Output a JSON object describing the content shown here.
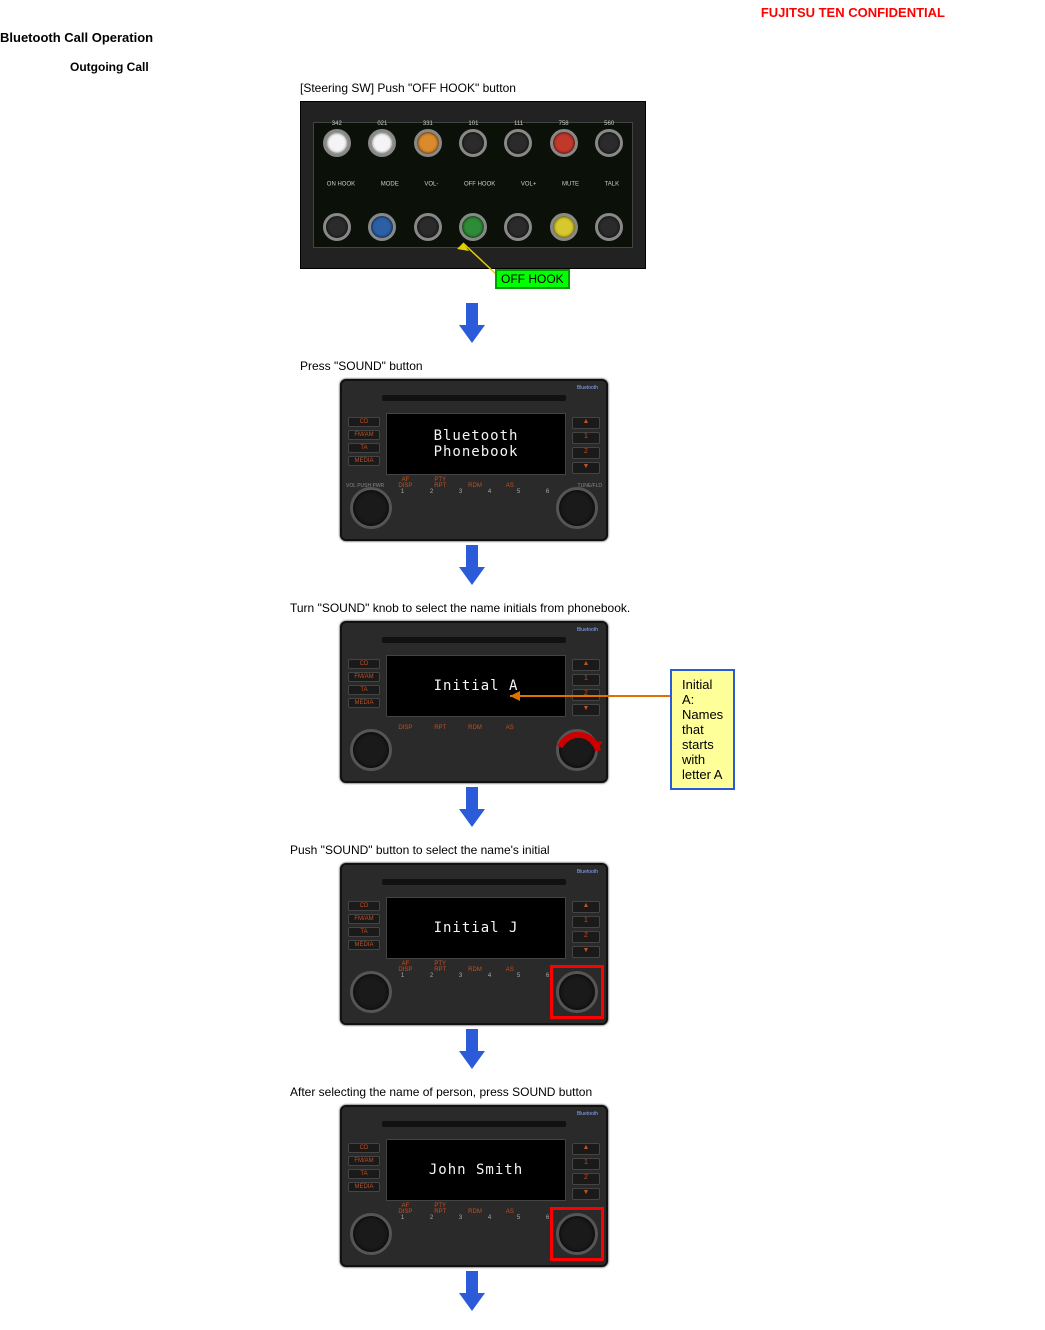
{
  "header": {
    "confidential": "FUJITSU TEN CONFIDENTIAL",
    "title": "Bluetooth Call Operation",
    "subtitle": "Outgoing Call"
  },
  "steps": [
    {
      "label": "[Steering SW] Push \"OFF HOOK\" button"
    },
    {
      "label": " Press \"SOUND\" button"
    },
    {
      "label": "Turn \"SOUND\" knob to select the name initials from phonebook."
    },
    {
      "label": "Push \"SOUND\" button to select the name's initial"
    },
    {
      "label": "After selecting the name of person, press SOUND button"
    }
  ],
  "callouts": {
    "off_hook": "OFF HOOK",
    "initial_annotation": "Initial A: Names that starts with letter A"
  },
  "sw_labels_top": [
    "342",
    "021",
    "",
    "331",
    "",
    "101",
    "",
    "111",
    "",
    "758",
    "",
    "560",
    ""
  ],
  "sw_labels_mid": [
    "ON HOOK",
    "MODE",
    "VOL-",
    "OFF HOOK",
    "VOL+",
    "MUTE",
    "TALK"
  ],
  "unit": {
    "side_buttons": [
      "CD",
      "FM/AM",
      "TA",
      "MEDIA"
    ],
    "side_buttons_r": [
      "▲",
      "1",
      "2",
      "▼"
    ],
    "row_buttons": [
      "AF",
      "PTY",
      "",
      "",
      ""
    ],
    "row_buttons2": [
      "DISP",
      "RPT",
      "RDM",
      "AS",
      ""
    ],
    "numbers": [
      "1",
      "2",
      "3",
      "4",
      "5",
      "6"
    ],
    "knob_l": "VOL PUSH PWR",
    "knob_r": "TUNE/FLD",
    "bt": "Bluetooth"
  },
  "screens": {
    "s1_line1": "Bluetooth",
    "s1_line2": "Phonebook",
    "s2_line1": "Initial A",
    "s3_line1": "Initial J",
    "s4_line1": "John Smith"
  }
}
